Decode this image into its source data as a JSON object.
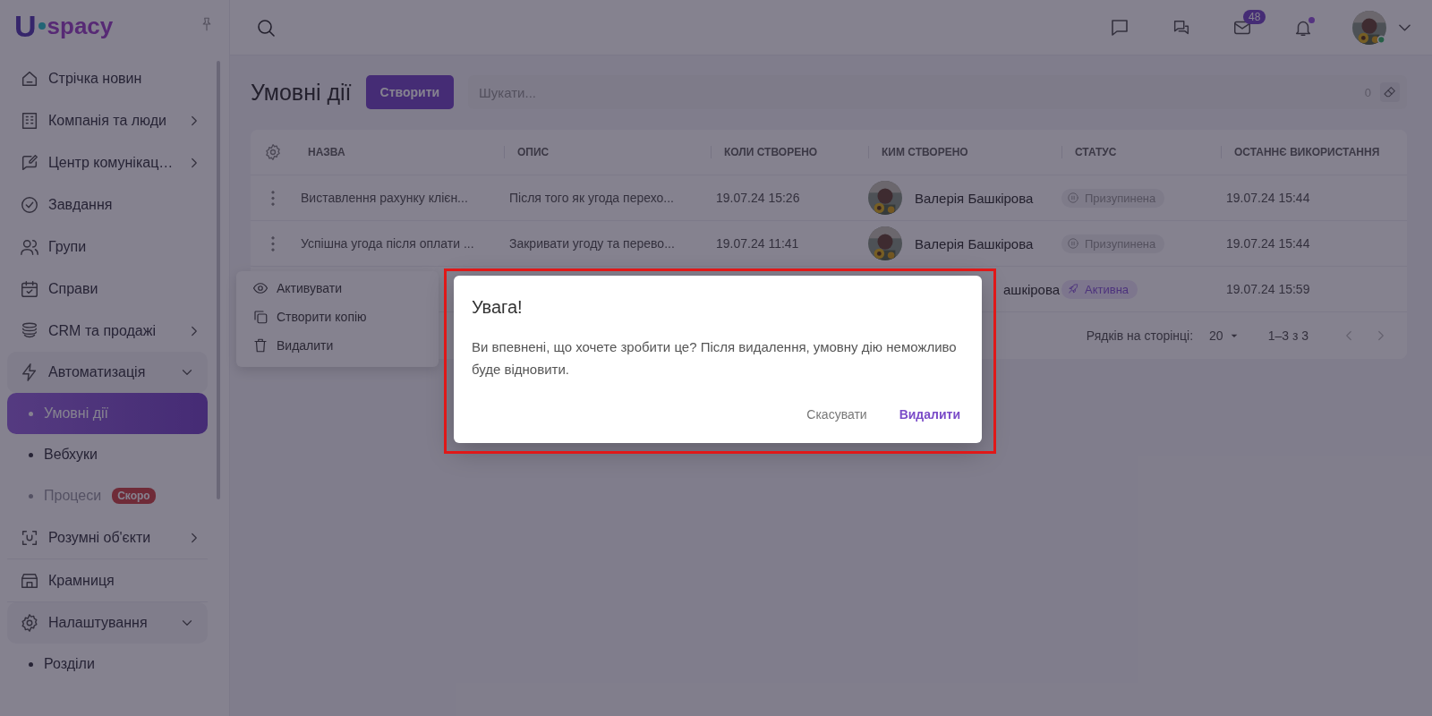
{
  "logo": {
    "mark": "U",
    "text": "spacy"
  },
  "sidebar": {
    "items": [
      {
        "label": "Стрічка новин"
      },
      {
        "label": "Компанія та люди",
        "expanded": false
      },
      {
        "label": "Центр комунікац…",
        "expanded": false
      },
      {
        "label": "Завдання"
      },
      {
        "label": "Групи"
      },
      {
        "label": "Справи"
      },
      {
        "label": "CRM та продажі",
        "expanded": false
      },
      {
        "label": "Автоматизація",
        "expanded": true,
        "children": [
          {
            "label": "Умовні дії",
            "selected": true,
            "disabled": false
          },
          {
            "label": "Вебхуки",
            "selected": false,
            "disabled": false
          },
          {
            "label": "Процеси",
            "selected": false,
            "disabled": true,
            "badge": "Скоро"
          }
        ]
      },
      {
        "label": "Розумні об'єкти",
        "expanded": false
      },
      {
        "label": "Крамниця"
      },
      {
        "label": "Налаштування",
        "expanded": true,
        "children": [
          {
            "label": "Розділи",
            "selected": false,
            "disabled": false
          }
        ]
      }
    ]
  },
  "header": {
    "mail_badge": "48",
    "notification_dot": true,
    "online": true
  },
  "page": {
    "title": "Умовні дії",
    "create_button": "Створити",
    "search": {
      "placeholder": "Шукати...",
      "count": "0"
    }
  },
  "table": {
    "columns": [
      "НАЗВА",
      "ОПИС",
      "КОЛИ СТВОРЕНО",
      "КИМ СТВОРЕНО",
      "СТАТУС",
      "ОСТАННЄ ВИКОРИСТАННЯ"
    ],
    "rows": [
      {
        "name": "Виставлення рахунку клієн...",
        "description": "Після того як угода перехо...",
        "created": "19.07.24 15:26",
        "author": "Валерія Башкірова",
        "status": {
          "label": "Призупинена",
          "kind": "paused"
        },
        "last_used": "19.07.24 15:44"
      },
      {
        "name": "Успішна угода після оплати ...",
        "description": "Закривати угоду та перево...",
        "created": "19.07.24 11:41",
        "author": "Валерія Башкірова",
        "status": {
          "label": "Призупинена",
          "kind": "paused"
        },
        "last_used": "19.07.24 15:44"
      },
      {
        "author": "ашкірова",
        "status": {
          "label": "Активна",
          "kind": "active"
        },
        "last_used": "19.07.24 15:59"
      }
    ],
    "pagination": {
      "rows_label": "Рядків на сторінці:",
      "rows_per_page": "20",
      "range": "1–3 з 3"
    }
  },
  "context_menu": {
    "items": [
      {
        "label": "Активувати",
        "kind": "activate"
      },
      {
        "label": "Створити копію",
        "kind": "copy"
      },
      {
        "label": "Видалити",
        "kind": "delete"
      }
    ]
  },
  "dialog": {
    "title": "Увага!",
    "text": "Ви впевнені, що хочете зробити це? Після видалення, умовну дію неможливо буде відновити.",
    "buttons": [
      {
        "label": "Скасувати",
        "kind": "cancel"
      },
      {
        "label": "Видалити",
        "kind": "confirm"
      }
    ]
  },
  "highlight": {
    "shown": true
  }
}
